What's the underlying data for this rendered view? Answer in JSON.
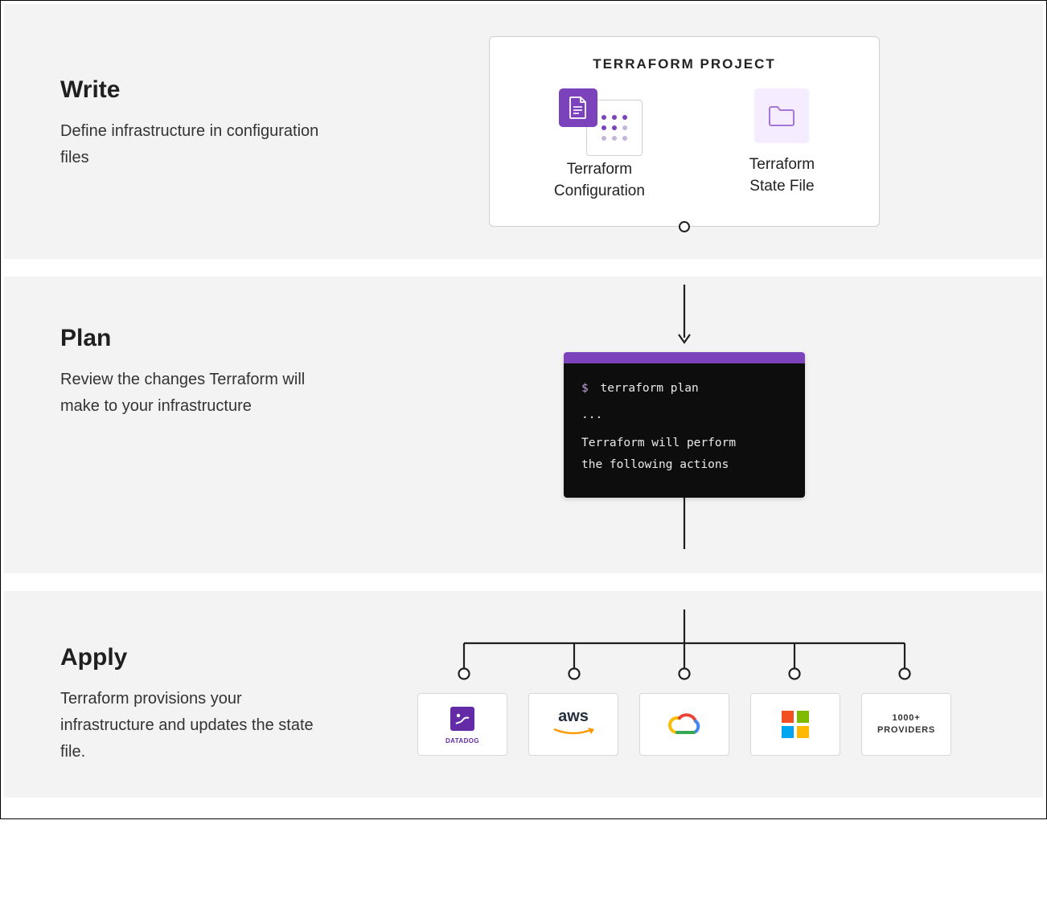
{
  "write": {
    "heading": "Write",
    "desc": "Define infrastructure in configuration files",
    "card_title": "TERRAFORM PROJECT",
    "config_label_line1": "Terraform",
    "config_label_line2": "Configuration",
    "state_label_line1": "Terraform",
    "state_label_line2": "State File"
  },
  "plan": {
    "heading": "Plan",
    "desc": "Review the changes Terraform will make to your infrastructure",
    "terminal_prompt": "$",
    "terminal_cmd": "terraform plan",
    "terminal_ellipsis": "...",
    "terminal_text_line1": "Terraform will perform",
    "terminal_text_line2": "the following actions"
  },
  "apply": {
    "heading": "Apply",
    "desc": "Terraform provisions your infrastructure and updates the state file.",
    "providers": {
      "datadog": "DATADOG",
      "aws": "aws",
      "gcp": "Google Cloud",
      "microsoft": "Microsoft",
      "more_line1": "1000+",
      "more_line2": "PROVIDERS"
    }
  }
}
